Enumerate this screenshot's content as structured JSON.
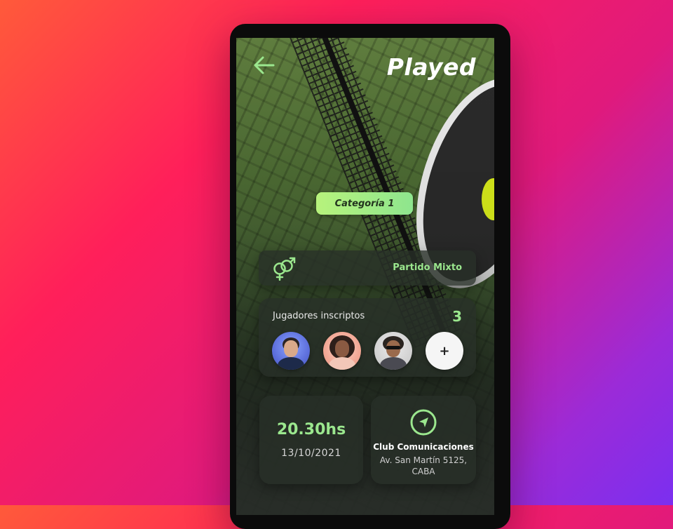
{
  "header": {
    "app_name": "Played",
    "back_icon": "arrow-left-icon"
  },
  "match": {
    "category": "Categoría 1",
    "type_icon": "gender-mixed-icon",
    "type_label": "Partido Mixto"
  },
  "players": {
    "title": "Jugadores inscriptos",
    "count": "3",
    "avatars": [
      "avatar-player-1",
      "avatar-player-2",
      "avatar-player-3"
    ],
    "add_label": "+"
  },
  "schedule": {
    "time": "20.30hs",
    "date": "13/10/2021"
  },
  "location": {
    "icon": "navigation-icon",
    "club": "Club Comunicaciones",
    "address_line1": "Av. San Martín 5125,",
    "address_line2": "CABA"
  },
  "colors": {
    "accent": "#9be78e",
    "category_bg": "#b7f37c",
    "card_bg": "#283028"
  }
}
